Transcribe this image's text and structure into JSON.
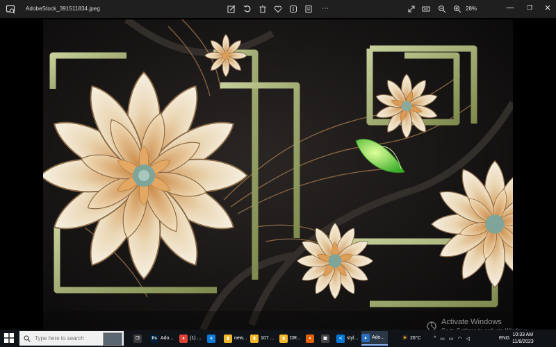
{
  "window": {
    "filename": "AdobeStock_391511834.jpeg",
    "zoom": "28%",
    "toolbar_icons": [
      "edit-image-icon",
      "rotate-icon",
      "delete-icon",
      "favorite-icon",
      "info-icon",
      "print-icon"
    ],
    "view_icons": [
      "fullscreen-icon",
      "fit-window-icon",
      "zoom-out-icon",
      "zoom-in-icon"
    ]
  },
  "watermark": {
    "title": "Activate Windows",
    "subtitle": "Go to Settings to activate Windows."
  },
  "taskbar": {
    "search_placeholder": "Type here to search",
    "apps": [
      {
        "name": "taskbar-task-view",
        "label": "",
        "color": "#3a3a3a",
        "glyph": "❐"
      },
      {
        "name": "taskbar-photoshop",
        "label": "Ado...",
        "color": "#001e36",
        "glyph": "Ps"
      },
      {
        "name": "taskbar-chrome",
        "label": "(1) ...",
        "color": "#db4437",
        "glyph": "●"
      },
      {
        "name": "taskbar-edge",
        "label": "",
        "color": "#0f7bd8",
        "glyph": "e"
      },
      {
        "name": "taskbar-folder-1",
        "label": "new...",
        "color": "#f3b82a",
        "glyph": "▮"
      },
      {
        "name": "taskbar-folder-2",
        "label": "107 ...",
        "color": "#f3b82a",
        "glyph": "▮"
      },
      {
        "name": "taskbar-folder-3",
        "label": "DR...",
        "color": "#f3b82a",
        "glyph": "▮"
      },
      {
        "name": "taskbar-firefox",
        "label": "",
        "color": "#e66000",
        "glyph": "●"
      },
      {
        "name": "taskbar-store",
        "label": "",
        "color": "#444",
        "glyph": "▦"
      },
      {
        "name": "taskbar-vscode",
        "label": "styl...",
        "color": "#0078d4",
        "glyph": "≺"
      },
      {
        "name": "taskbar-photos",
        "label": "Ado...",
        "color": "#2a6ebd",
        "glyph": "▲"
      }
    ],
    "weather": "26°C",
    "language": "ENG",
    "time": "10:33 AM",
    "date": "11/8/2023"
  }
}
